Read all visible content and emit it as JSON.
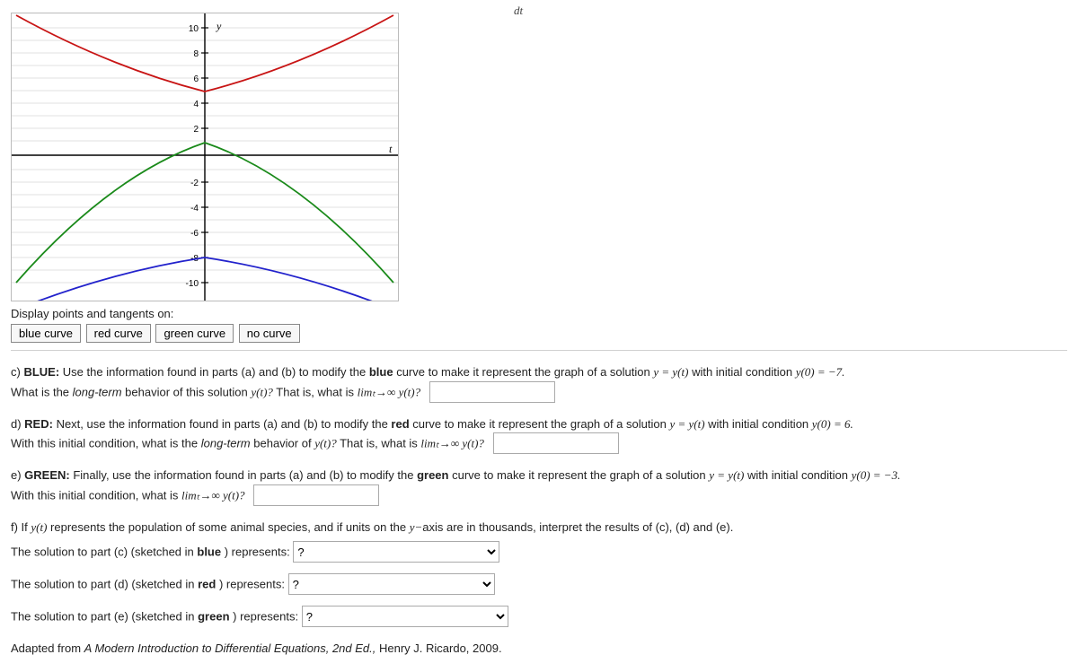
{
  "top_fragment": "dt",
  "chart_data": {
    "type": "line",
    "xlabel": "t",
    "ylabel": "y",
    "xlim": [
      -3,
      3
    ],
    "ylim": [
      -10,
      10
    ],
    "yticks": [
      -10,
      -8,
      -6,
      -4,
      -2,
      2,
      4,
      6,
      8,
      10
    ],
    "series": [
      {
        "name": "red",
        "color": "#c81414",
        "x": [
          -3,
          -2,
          -1,
          0,
          1,
          2,
          3
        ],
        "values": [
          11,
          8,
          6,
          5,
          6,
          8,
          11
        ]
      },
      {
        "name": "green",
        "color": "#1a8a1a",
        "x": [
          -3,
          -2,
          -1,
          0,
          1,
          2,
          3
        ],
        "values": [
          -10,
          -4,
          0,
          1,
          0,
          -4,
          -10
        ]
      },
      {
        "name": "blue",
        "color": "#2222cc",
        "x": [
          -3,
          -2,
          -1,
          0,
          1,
          2,
          3
        ],
        "values": [
          -12,
          -10,
          -8.5,
          -8,
          -8.5,
          -10,
          -12
        ]
      }
    ]
  },
  "display_label": "Display points and tangents on:",
  "buttons": {
    "blue": "blue curve",
    "red": "red curve",
    "green": "green curve",
    "none": "no curve"
  },
  "c": {
    "lead": "c) ",
    "tag": "BLUE:",
    "body1": " Use the information found in parts (a) and (b) to modify the ",
    "blueword": "blue",
    "body2": " curve to make it represent the graph of a solution ",
    "eq1": "y = y(t)",
    "body3": " with initial condition ",
    "eq2": "y(0) = −7.",
    "line2a": "What is the ",
    "italic": "long-term",
    "line2b": " behavior of this solution ",
    "eq3": "y(t)?",
    "line2c": " That is, what is ",
    "lim": "limₜ→∞ y(t)?"
  },
  "d": {
    "lead": "d) ",
    "tag": "RED:",
    "body1": " Next, use the information found in parts (a) and (b) to modify the ",
    "redword": "red",
    "body2": " curve to make it represent the graph of a solution ",
    "eq1": "y = y(t)",
    "body3": " with initial condition ",
    "eq2": "y(0) = 6.",
    "line2a": "With this initial condition, what is the ",
    "italic": "long-term",
    "line2b": " behavior of ",
    "eq3": "y(t)?",
    "line2c": " That is, what is ",
    "lim": "limₜ→∞ y(t)?"
  },
  "e": {
    "lead": "e) ",
    "tag": "GREEN:",
    "body1": " Finally, use the information found in parts (a) and (b) to modify the ",
    "greenword": "green",
    "body2": " curve to make it represent the graph of a solution ",
    "eq1": "y = y(t)",
    "body3": " with initial condition ",
    "eq2": "y(0) = −3.",
    "line2a": "With this initial condition, what is ",
    "lim": "limₜ→∞ y(t)?"
  },
  "f": {
    "lead": "f) If ",
    "eq1": "y(t)",
    "body1": " represents the population of some animal species, and if units on the ",
    "eq2": "y−",
    "body2": "axis are in thousands, interpret the results of (c), (d) and (e).",
    "row_c_a": "The solution to part (c) (sketched in ",
    "row_c_b": "blue",
    "row_c_c": " ) represents:",
    "row_d_a": "The solution to part (d) (sketched in ",
    "row_d_b": "red",
    "row_d_c": " ) represents:",
    "row_e_a": "The solution to part (e) (sketched in ",
    "row_e_b": "green",
    "row_e_c": " ) represents:",
    "select_placeholder": "?"
  },
  "citation": {
    "a": "Adapted from ",
    "title": "A Modern Introduction to Differential Equations, 2nd Ed.,",
    "b": " Henry J. Ricardo, 2009."
  }
}
